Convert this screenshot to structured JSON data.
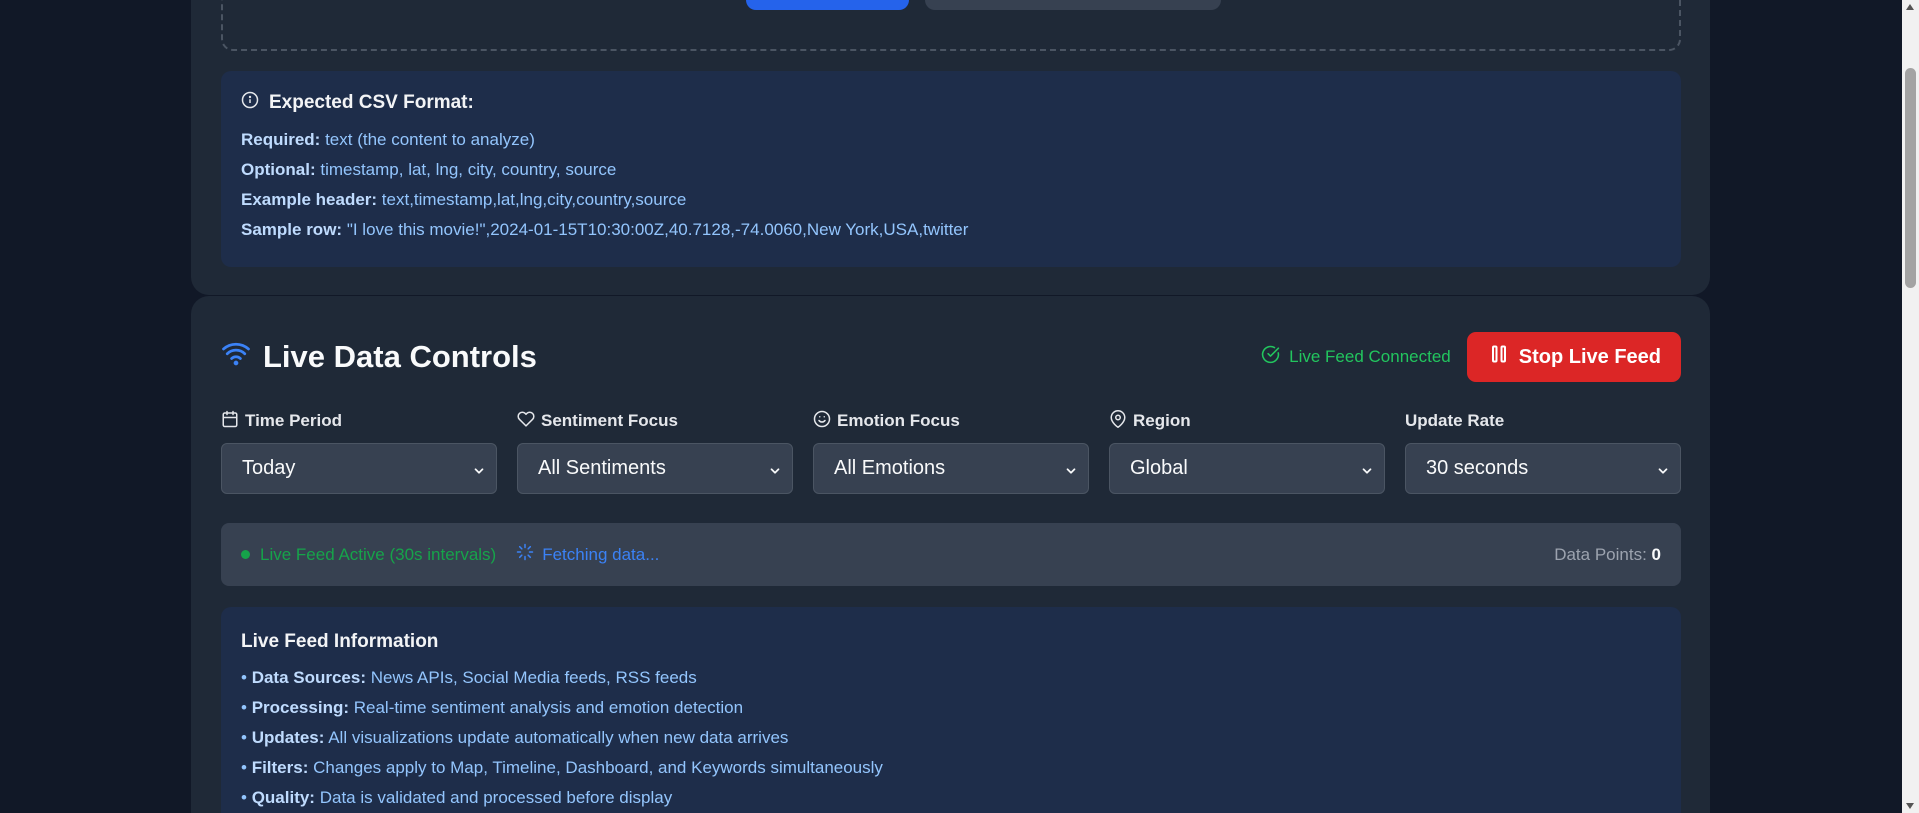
{
  "csv_format": {
    "title": "Expected CSV Format:",
    "lines": [
      {
        "label": "Required:",
        "value": "text (the content to analyze)"
      },
      {
        "label": "Optional:",
        "value": "timestamp, lat, lng, city, country, source"
      },
      {
        "label": "Example header:",
        "value": "text,timestamp,lat,lng,city,country,source"
      },
      {
        "label": "Sample row:",
        "value": "\"I love this movie!\",2024-01-15T10:30:00Z,40.7128,-74.0060,New York,USA,twitter"
      }
    ]
  },
  "live_controls": {
    "title": "Live Data Controls",
    "connection_status": "Live Feed Connected",
    "stop_button": "Stop Live Feed",
    "filters": [
      {
        "label": "Time Period",
        "icon": "calendar-icon",
        "value": "Today"
      },
      {
        "label": "Sentiment Focus",
        "icon": "heart-icon",
        "value": "All Sentiments"
      },
      {
        "label": "Emotion Focus",
        "icon": "smile-icon",
        "value": "All Emotions"
      },
      {
        "label": "Region",
        "icon": "map-pin-icon",
        "value": "Global"
      },
      {
        "label": "Update Rate",
        "icon": "",
        "value": "30 seconds"
      }
    ],
    "status": {
      "active_text": "Live Feed Active (30s intervals)",
      "fetching_text": "Fetching data...",
      "data_points_label": "Data Points:",
      "data_points_value": "0"
    }
  },
  "feed_info": {
    "title": "Live Feed Information",
    "items": [
      {
        "label": "Data Sources:",
        "value": "News APIs, Social Media feeds, RSS feeds"
      },
      {
        "label": "Processing:",
        "value": "Real-time sentiment analysis and emotion detection"
      },
      {
        "label": "Updates:",
        "value": "All visualizations update automatically when new data arrives"
      },
      {
        "label": "Filters:",
        "value": "Changes apply to Map, Timeline, Dashboard, and Keywords simultaneously"
      },
      {
        "label": "Quality:",
        "value": "Data is validated and processed before display"
      }
    ]
  },
  "colors": {
    "page_bg": "#111827",
    "card_bg": "#1f2937",
    "info_bg": "#1e2d4a",
    "accent_blue": "#2563eb",
    "success_green": "#16a34a",
    "danger_red": "#dc2626"
  }
}
